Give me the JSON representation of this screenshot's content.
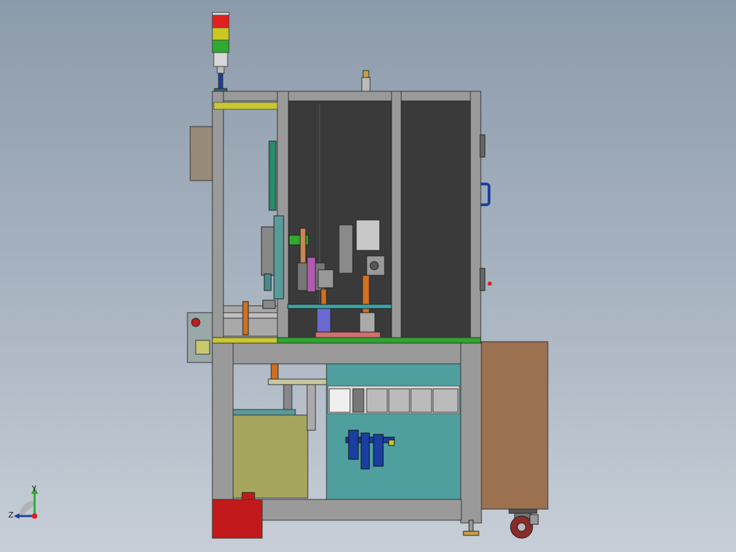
{
  "view": {
    "triad": {
      "x_label": "",
      "y_label": "Y",
      "z_label": "Z"
    }
  },
  "colors": {
    "frame": "#9a9a9a",
    "frame_dark": "#5e5e5e",
    "panel_dark": "#3a3a3a",
    "base_plate": "#2fa52f",
    "electrical_panel": "#4f9f9f",
    "cabinet_side": "#9b7150",
    "lower_box": "#a5a55e",
    "red_block": "#c21a1a",
    "signal_red": "#e02020",
    "signal_yellow": "#c8c820",
    "signal_green": "#2eaa2e",
    "handle_blue": "#1a3fa0"
  }
}
